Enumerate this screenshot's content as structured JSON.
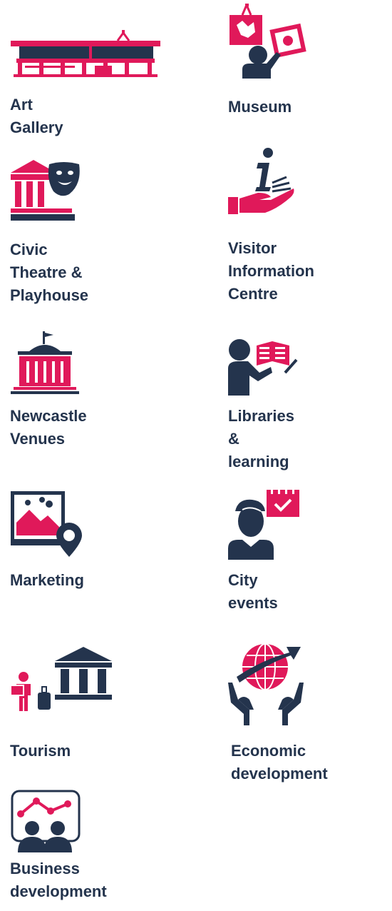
{
  "colors": {
    "navy": "#24344d",
    "pink": "#e0195a"
  },
  "services": [
    {
      "label": "Art Gallery",
      "icon": "art-gallery-building-icon"
    },
    {
      "label": "Museum",
      "icon": "museum-exhibit-icon"
    },
    {
      "label": "Civic Theatre &\nPlayhouse",
      "icon": "theatre-mask-icon"
    },
    {
      "label": "Visitor Information\nCentre",
      "icon": "information-hand-icon"
    },
    {
      "label": "Newcastle\nVenues",
      "icon": "venue-building-icon"
    },
    {
      "label": "Libraries &\nlearning",
      "icon": "reader-book-icon"
    },
    {
      "label": "Marketing",
      "icon": "picture-location-icon"
    },
    {
      "label": "City events",
      "icon": "person-calendar-icon"
    },
    {
      "label": "Tourism",
      "icon": "tourist-landmark-icon"
    },
    {
      "label": "Economic\ndevelopment",
      "icon": "globe-growth-icon"
    },
    {
      "label": "Business\ndevelopment",
      "icon": "business-chart-icon"
    }
  ]
}
